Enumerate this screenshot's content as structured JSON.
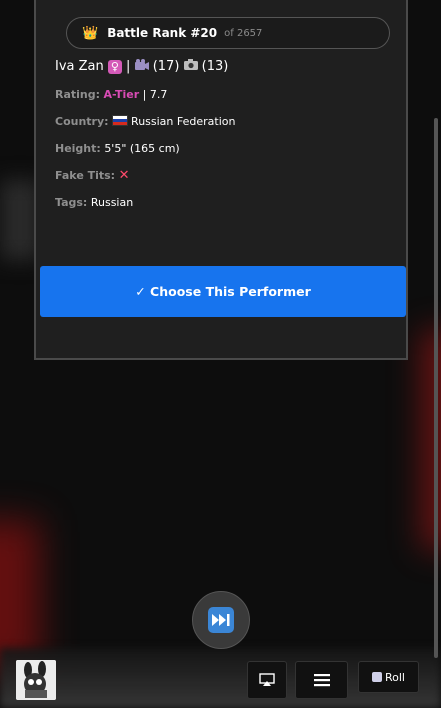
{
  "rank": {
    "label": "Battle Rank #20",
    "of": "of 2657"
  },
  "performer": {
    "name": "Iva Zan",
    "separator": "|",
    "videos_count": "(17)",
    "photos_count": "(13)"
  },
  "fields": {
    "rating_label": "Rating:",
    "rating_tier": "A-Tier",
    "rating_score": "| 7.7",
    "country_label": "Country:",
    "country_value": "Russian Federation",
    "height_label": "Height:",
    "height_value": "5'5\" (165 cm)",
    "fake_tits_label": "Fake Tits:",
    "tags_label": "Tags:",
    "tags_value": "Russian"
  },
  "choose_button": "✓ Choose This Performer",
  "roll_button": "Roll",
  "icons": {
    "rank": "crown-icon",
    "gender": "venus-icon",
    "videos": "video-camera-icon",
    "photos": "camera-icon",
    "country": "russia-flag-icon",
    "fake_tits": "x-mark-icon",
    "skip": "fast-forward-icon",
    "airplay": "airplay-icon",
    "menu": "hamburger-icon",
    "roll": "dice-icon"
  },
  "colors": {
    "accent": "#1774ee",
    "tier": "#d84bb4",
    "cross": "#ff4a6b"
  }
}
